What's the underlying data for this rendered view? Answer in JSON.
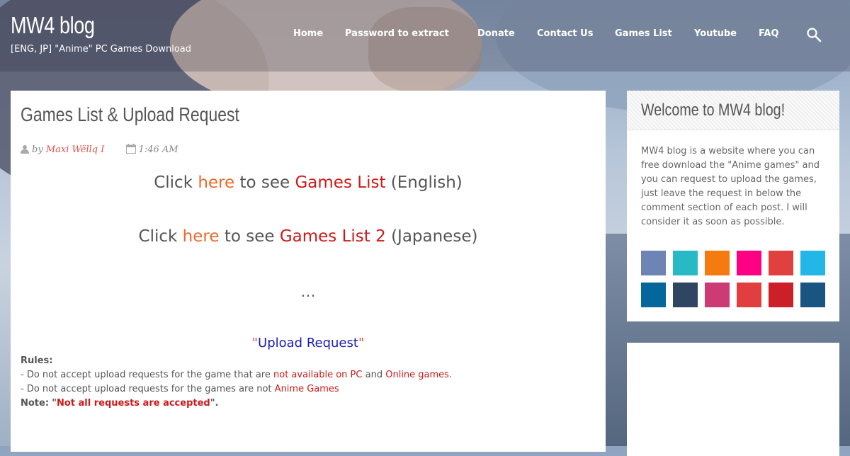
{
  "header": {
    "site_title": "MW4 blog",
    "tagline": "[ENG, JP] \"Anime\" PC Games Download",
    "nav": [
      {
        "label": "Home"
      },
      {
        "label": "Password to extract"
      },
      {
        "label": "Donate"
      },
      {
        "label": "Contact Us"
      },
      {
        "label": "Games List"
      },
      {
        "label": "Youtube"
      },
      {
        "label": "FAQ"
      }
    ],
    "search_icon": "search-icon"
  },
  "post": {
    "title": "Games List & Upload Request",
    "meta_by": "by",
    "author": "Maxi Wëllq I",
    "time": "1:46 AM",
    "line1": {
      "click": "Click",
      "here": "here",
      "to_see": "to see",
      "link": "Games List",
      "lang": "(English)"
    },
    "line2": {
      "click": "Click",
      "here": "here",
      "to_see": "to see",
      "link": "Games List 2",
      "lang": "(Japanese)"
    },
    "ellipsis": "...",
    "upload_quote_open": "\"",
    "upload_request": "Upload Request",
    "upload_quote_close": "\"",
    "rules_label": "Rules:",
    "rule1_prefix": "- Do not accept upload requests for the game that are",
    "rule1_red1": "not available on PC",
    "rule1_and": "and",
    "rule1_red2": "Online games",
    "rule1_end": ".",
    "rule2_prefix": "- Do not accept upload requests for the games are not",
    "rule2_red": "Anime Games",
    "note_label": "Note:",
    "note_quote_open": "\"",
    "note_red": "Not all requests are accepted",
    "note_end": "\"."
  },
  "sidebar": {
    "title": "Welcome to MW4 blog!",
    "text": "MW4 blog is a website where you can free download the \"Anime games\" and you can request to upload the games, just leave the request in below the comment section of each post. I will consider it as soon as possible.",
    "social_colors": [
      "#6d84b4",
      "#27b9c6",
      "#f57a0f",
      "#ff0084",
      "#e0403e",
      "#23b7e8",
      "#04669b",
      "#2f4562",
      "#cc3b73",
      "#e13f3f",
      "#cb2027",
      "#1a5582"
    ]
  }
}
